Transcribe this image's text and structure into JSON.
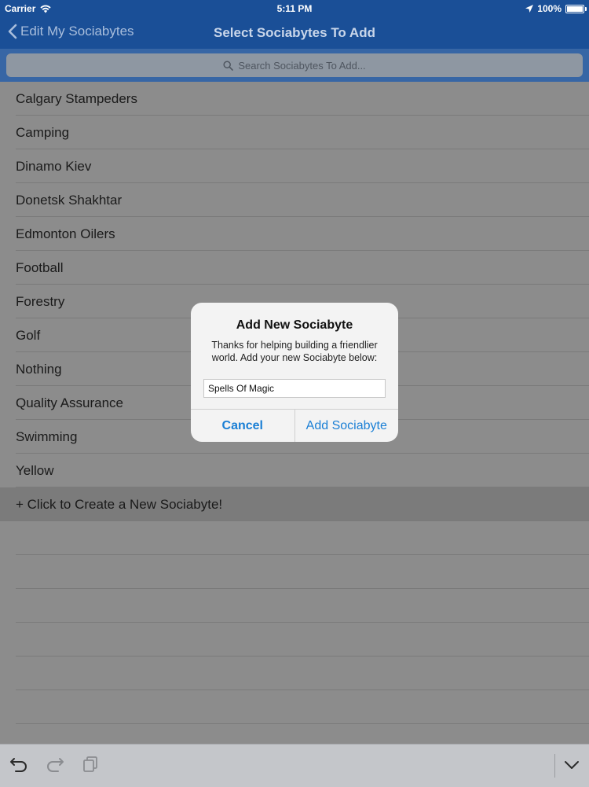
{
  "status_bar": {
    "carrier": "Carrier",
    "time": "5:11 PM",
    "battery": "100%"
  },
  "nav": {
    "back_label": "Edit My Sociabytes",
    "title": "Select Sociabytes To Add"
  },
  "search": {
    "placeholder": "Search Sociabytes To Add..."
  },
  "list": {
    "items": [
      "Calgary Stampeders",
      "Camping",
      "Dinamo Kiev",
      "Donetsk Shakhtar",
      "Edmonton Oilers",
      "Football",
      "Forestry",
      "Golf",
      "Nothing",
      "Quality Assurance",
      "Swimming",
      "Yellow"
    ],
    "create_label": "+ Click to Create a New Sociabyte!"
  },
  "alert": {
    "title": "Add New Sociabyte",
    "message": "Thanks for helping building a friendlier world. Add your new Sociabyte below:",
    "input_value": "Spells Of Magic",
    "cancel_label": "Cancel",
    "confirm_label": "Add Sociabyte"
  },
  "colors": {
    "nav": "#1a4f97",
    "accent": "#1a7fd5",
    "overlay": "#8c8c8c"
  },
  "icons": [
    "wifi-icon",
    "location-arrow-icon",
    "battery-icon",
    "chevron-left-icon",
    "search-icon",
    "undo-icon",
    "redo-icon",
    "paste-icon",
    "chevron-down-icon"
  ]
}
